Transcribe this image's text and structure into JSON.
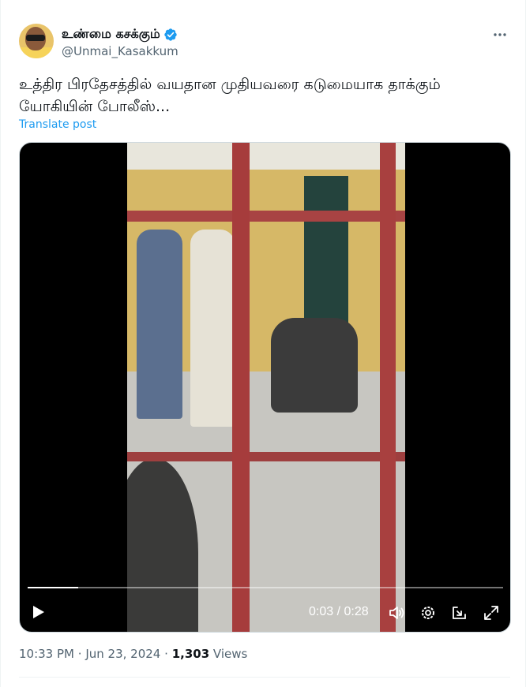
{
  "author": {
    "display_name": "உண்மை கசக்கும்",
    "handle": "@Unmai_Kasakkum",
    "verified": true
  },
  "tweet": {
    "text": "உத்திர பிரதேசத்தில் வயதான முதியவரை கடுமையாக தாக்கும் யோகியின் போலீஸ்...",
    "translate_label": "Translate post"
  },
  "video": {
    "current_time": "0:03",
    "separator": "/",
    "duration": "0:28",
    "progress_fraction": 0.107
  },
  "meta": {
    "time": "10:33 PM",
    "dot1": "·",
    "date": "Jun 23, 2024",
    "dot2": "·",
    "views_count": "1,303",
    "views_label": "Views"
  },
  "colors": {
    "link": "#1d9bf0",
    "verified": "#1d9bf0",
    "secondary_text": "#536471"
  },
  "icons": [
    "more-icon",
    "verified-icon",
    "play-icon",
    "volume-icon",
    "settings-icon",
    "popout-icon",
    "fullscreen-icon"
  ]
}
